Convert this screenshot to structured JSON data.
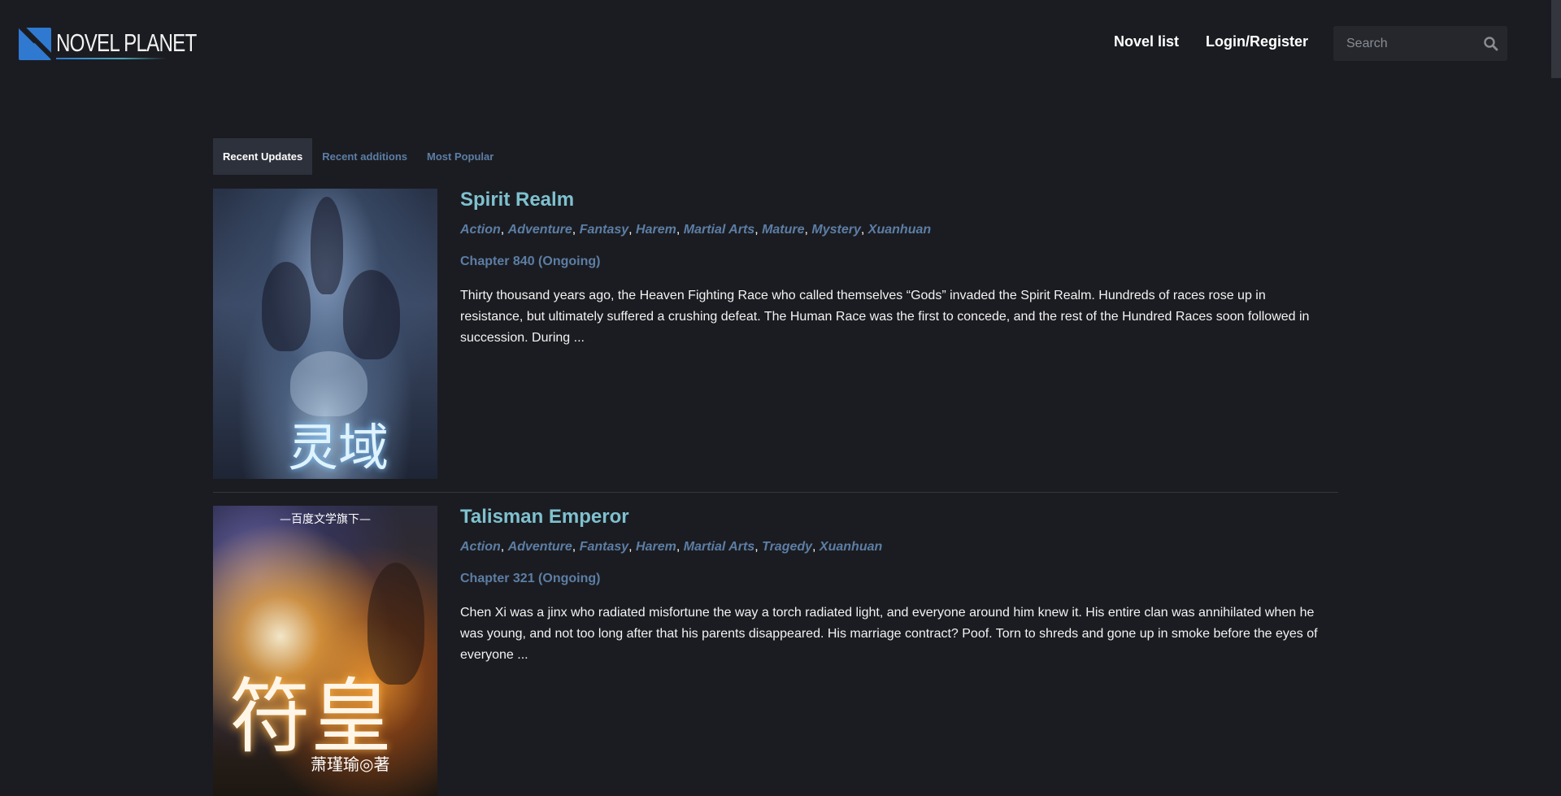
{
  "header": {
    "logo_text": "NOVEL PLANET",
    "nav": [
      {
        "label": "Novel list"
      },
      {
        "label": "Login/Register"
      }
    ],
    "search": {
      "placeholder": "Search"
    }
  },
  "tabs": [
    {
      "label": "Recent Updates",
      "active": true
    },
    {
      "label": "Recent additions",
      "active": false
    },
    {
      "label": "Most Popular",
      "active": false
    }
  ],
  "novels": [
    {
      "title": "Spirit Realm",
      "genres": [
        "Action",
        "Adventure",
        "Fantasy",
        "Harem",
        "Martial Arts",
        "Mature",
        "Mystery",
        "Xuanhuan"
      ],
      "chapter": "Chapter 840 (Ongoing)",
      "summary": "Thirty thousand years ago, the Heaven Fighting Race who called themselves “Gods” invaded the Spirit Realm. Hundreds of races rose up in resistance, but ultimately suffered a crushing defeat. The Human Race was the first to concede, and the rest of the Hundred Races soon followed in succession. During ...",
      "cover_glyph": "灵域"
    },
    {
      "title": "Talisman Emperor",
      "genres": [
        "Action",
        "Adventure",
        "Fantasy",
        "Harem",
        "Martial Arts",
        "Tragedy",
        "Xuanhuan"
      ],
      "chapter": "Chapter 321 (Ongoing)",
      "summary": "Chen Xi was a jinx who radiated misfortune the way a torch radiated light, and everyone around him knew it. His entire clan was annihilated when he was young, and not too long after that his parents disappeared. His marriage contract? Poof. Torn to shreds and gone up in smoke before the eyes of everyone ...",
      "cover_banner": "—百度文学旗下—",
      "cover_glyph": "符皇",
      "cover_author": "萧瑾瑜◎著"
    }
  ],
  "colors": {
    "background": "#1b1c21",
    "title": "#7ec1cf",
    "link": "#5c7ea5",
    "tab_active_bg": "#2d313b"
  },
  "icons": {
    "logo": "novel-planet-logo-icon",
    "search": "search-icon"
  }
}
